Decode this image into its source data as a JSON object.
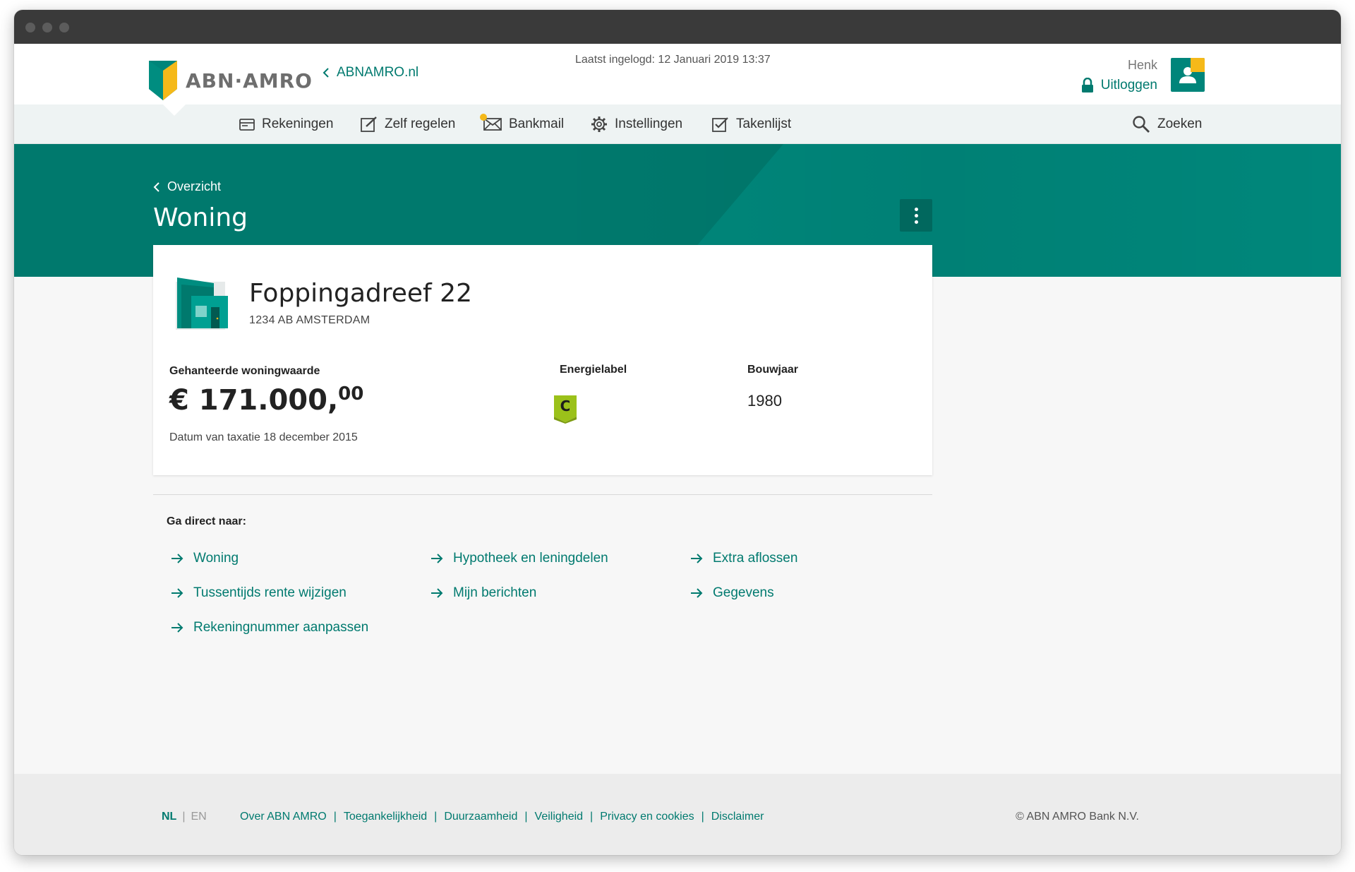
{
  "header": {
    "logo_text": "ABN·AMRO",
    "site_link": "ABNAMRO.nl",
    "last_login": "Laatst ingelogd: 12 Januari 2019 13:37",
    "user_name": "Henk",
    "logout_label": "Uitloggen"
  },
  "nav": {
    "items": [
      {
        "label": "Rekeningen",
        "icon": "wallet-icon"
      },
      {
        "label": "Zelf regelen",
        "icon": "edit-icon"
      },
      {
        "label": "Bankmail",
        "icon": "mail-icon"
      },
      {
        "label": "Instellingen",
        "icon": "gear-icon"
      },
      {
        "label": "Takenlijst",
        "icon": "checkbox-icon"
      }
    ],
    "search_label": "Zoeken"
  },
  "hero": {
    "back_label": "Overzicht",
    "title": "Woning"
  },
  "property": {
    "address": "Foppingadreef 22",
    "city": "1234 AB AMSTERDAM",
    "value_label": "Gehanteerde woningwaarde",
    "value_main": "€ 171.000,",
    "value_cents": "00",
    "taxatie": "Datum van taxatie 18 december 2015",
    "energy_label_title": "Energielabel",
    "energy_label_value": "C",
    "year_title": "Bouwjaar",
    "year_value": "1980"
  },
  "quick": {
    "title": "Ga direct naar:",
    "links": [
      "Woning",
      "Hypotheek en leningdelen",
      "Extra aflossen",
      "Tussentijds rente wijzigen",
      "Mijn berichten",
      "Gegevens",
      "Rekeningnummer aanpassen"
    ]
  },
  "footer": {
    "lang_active": "NL",
    "lang_sep": "|",
    "lang_other": "EN",
    "links": [
      "Over ABN AMRO",
      "Toegankelijkheid",
      "Duurzaamheid",
      "Veiligheid",
      "Privacy en cookies",
      "Disclaimer"
    ],
    "link_sep": "|",
    "copyright": "© ABN AMRO Bank N.V."
  },
  "colors": {
    "brand_green": "#00796d",
    "link_green": "#007a6f",
    "brand_yellow": "#f5b919",
    "energy_c": "#9bc11a"
  }
}
